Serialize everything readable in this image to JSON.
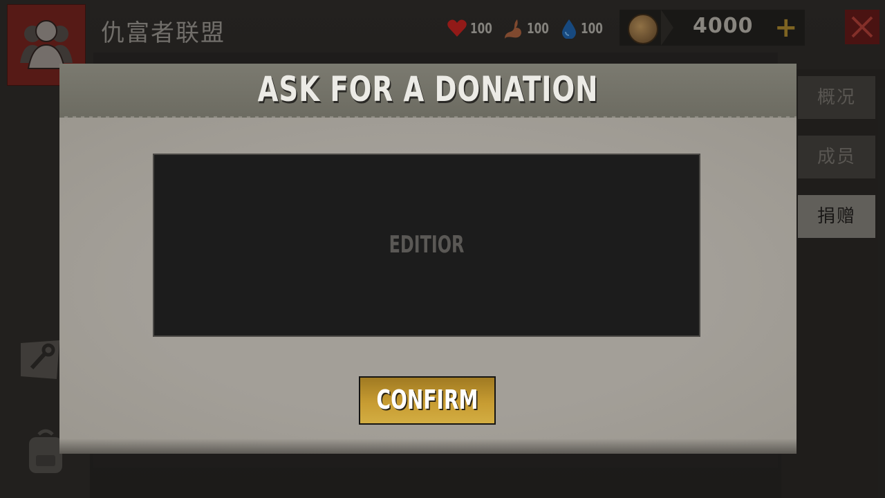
{
  "header": {
    "guild_name": "仇富者联盟",
    "stats": [
      {
        "icon": "heart-icon",
        "value": "100",
        "color": "#b2201e"
      },
      {
        "icon": "stomach-icon",
        "value": "100",
        "color": "#9b5a3a"
      },
      {
        "icon": "water-drop-icon",
        "value": "100",
        "color": "#1d5a9b"
      }
    ],
    "currency": {
      "icon": "coin-icon",
      "value": "4000"
    }
  },
  "side_tabs": [
    {
      "label": "概况",
      "active": false
    },
    {
      "label": "成员",
      "active": false
    },
    {
      "label": "捐赠",
      "active": true
    }
  ],
  "modal": {
    "title": "ASK FOR A DONATION",
    "editor_placeholder": "EDITIOR",
    "confirm_label": "CONFIRM"
  },
  "colors": {
    "accent_gold": "#c79c32",
    "close_red": "#5b1816",
    "avatar_red": "#6a201c"
  }
}
